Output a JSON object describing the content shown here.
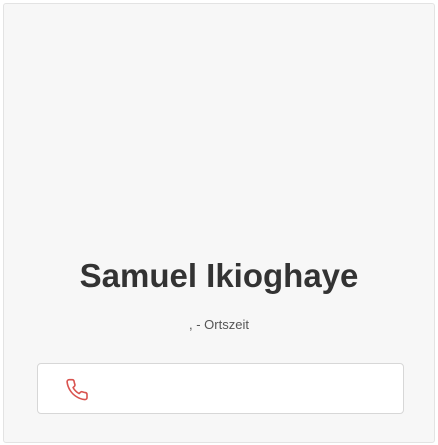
{
  "contact": {
    "name": "Samuel Ikioghaye",
    "local_time": ", - Ortszeit",
    "phone": {
      "icon": "phone-icon",
      "value": ""
    }
  },
  "colors": {
    "card_background": "#f7f7f7",
    "card_border": "#e3e3e3",
    "name_text": "#333333",
    "phone_icon": "#d9534f"
  }
}
